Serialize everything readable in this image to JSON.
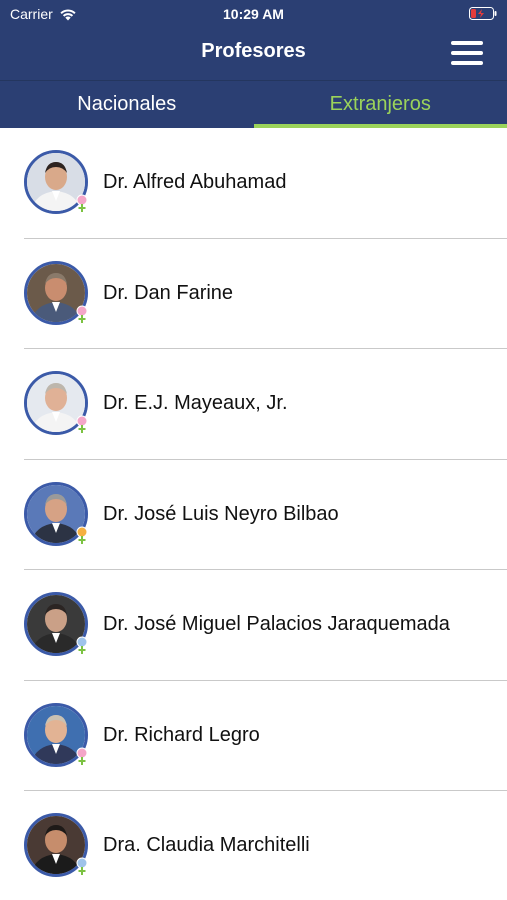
{
  "status_bar": {
    "carrier": "Carrier",
    "time": "10:29 AM"
  },
  "nav": {
    "title": "Profesores"
  },
  "tabs": {
    "nacionales": "Nacionales",
    "extranjeros": "Extranjeros",
    "selected": "Extranjeros"
  },
  "colors": {
    "header": "#2b3f73",
    "accent": "#9bd35a",
    "avatar_ring": "#3b5aa8"
  },
  "professors": [
    {
      "name": "Dr. Alfred Abuhamad",
      "badge": "pink"
    },
    {
      "name": "Dr. Dan Farine",
      "badge": "pink"
    },
    {
      "name": "Dr. E.J. Mayeaux, Jr.",
      "badge": "pink"
    },
    {
      "name": "Dr. José Luis Neyro Bilbao",
      "badge": "orange"
    },
    {
      "name": "Dr. José Miguel Palacios Jaraquemada",
      "badge": "blue"
    },
    {
      "name": "Dr. Richard Legro",
      "badge": "pink"
    },
    {
      "name": "Dra. Claudia Marchitelli",
      "badge": "blue"
    }
  ]
}
